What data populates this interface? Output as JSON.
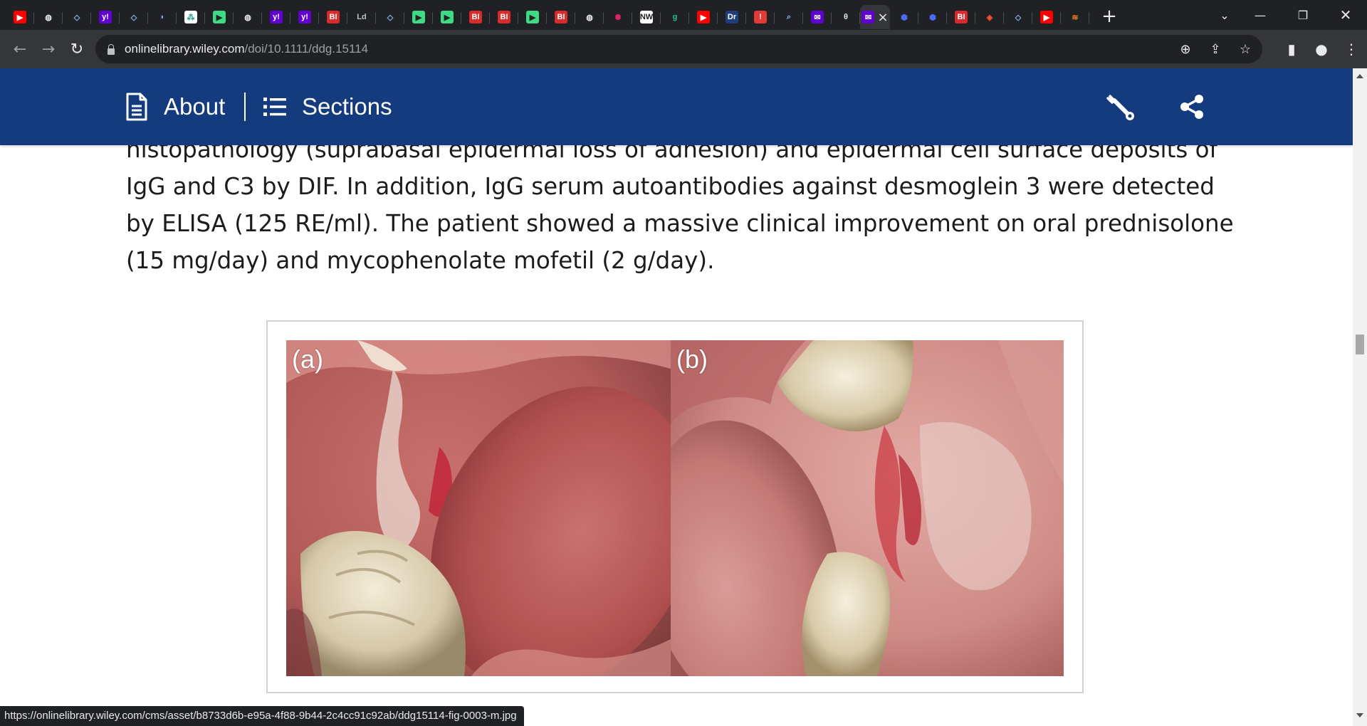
{
  "browser": {
    "tabs": [
      {
        "icon": "youtube-icon",
        "glyph": "▶",
        "bg": "#ff0000",
        "fg": "#ffffff"
      },
      {
        "icon": "globe-icon",
        "glyph": "◍",
        "bg": "#202124",
        "fg": "#e8eaed"
      },
      {
        "icon": "shield-icon",
        "glyph": "◇",
        "bg": "#202124",
        "fg": "#8ab4f8"
      },
      {
        "icon": "yahoo-icon",
        "glyph": "y!",
        "bg": "#6001d2",
        "fg": "#ffffff"
      },
      {
        "icon": "shield-icon",
        "glyph": "◇",
        "bg": "#202124",
        "fg": "#8ab4f8"
      },
      {
        "icon": "dart-icon",
        "glyph": "◗",
        "bg": "#202124",
        "fg": "#8ab4f8"
      },
      {
        "icon": "map-icon",
        "glyph": "⁂",
        "bg": "#ffffff",
        "fg": "#2a9d8f"
      },
      {
        "icon": "play-icon",
        "glyph": "▶",
        "bg": "#3ddc84",
        "fg": "#202124"
      },
      {
        "icon": "globe-icon",
        "glyph": "◍",
        "bg": "#202124",
        "fg": "#e8eaed"
      },
      {
        "icon": "yahoo-icon",
        "glyph": "y!",
        "bg": "#6001d2",
        "fg": "#ffffff"
      },
      {
        "icon": "yahoo-icon",
        "glyph": "y!",
        "bg": "#6001d2",
        "fg": "#ffffff"
      },
      {
        "icon": "business-insider-icon",
        "glyph": "BI",
        "bg": "#d92b2b",
        "fg": "#ffffff"
      },
      {
        "icon": "text-logo-icon",
        "glyph": "Ld",
        "bg": "#202124",
        "fg": "#bdc1c6"
      },
      {
        "icon": "shield-icon",
        "glyph": "◇",
        "bg": "#202124",
        "fg": "#8ab4f8"
      },
      {
        "icon": "play-icon",
        "glyph": "▶",
        "bg": "#3ddc84",
        "fg": "#202124"
      },
      {
        "icon": "play-icon",
        "glyph": "▶",
        "bg": "#3ddc84",
        "fg": "#202124"
      },
      {
        "icon": "business-insider-icon",
        "glyph": "BI",
        "bg": "#d92b2b",
        "fg": "#ffffff"
      },
      {
        "icon": "business-insider-icon",
        "glyph": "BI",
        "bg": "#d92b2b",
        "fg": "#ffffff"
      },
      {
        "icon": "play-icon",
        "glyph": "▶",
        "bg": "#3ddc84",
        "fg": "#202124"
      },
      {
        "icon": "business-insider-icon",
        "glyph": "BI",
        "bg": "#d92b2b",
        "fg": "#ffffff"
      },
      {
        "icon": "globe-icon",
        "glyph": "◍",
        "bg": "#202124",
        "fg": "#e8eaed"
      },
      {
        "icon": "starburst-icon",
        "glyph": "✺",
        "bg": "#202124",
        "fg": "#e0245e"
      },
      {
        "icon": "news-logo-icon",
        "glyph": "NW",
        "bg": "#ffffff",
        "fg": "#202124"
      },
      {
        "icon": "g-logo-icon",
        "glyph": "g",
        "bg": "#202124",
        "fg": "#15c39a"
      },
      {
        "icon": "youtube-icon",
        "glyph": "▶",
        "bg": "#ff0000",
        "fg": "#ffffff"
      },
      {
        "icon": "dr-logo-icon",
        "glyph": "Dr",
        "bg": "#1f3f7a",
        "fg": "#ffffff"
      },
      {
        "icon": "red-exclaim-icon",
        "glyph": "!",
        "bg": "#e53935",
        "fg": "#ffffff"
      },
      {
        "icon": "search-icon",
        "glyph": "⌕",
        "bg": "#202124",
        "fg": "#8ab4f8"
      },
      {
        "icon": "mail-icon",
        "glyph": "✉",
        "bg": "#6001d2",
        "fg": "#ffffff"
      },
      {
        "icon": "theta-icon",
        "glyph": "θ",
        "bg": "#202124",
        "fg": "#e8eaed"
      },
      {
        "icon": "mail-icon",
        "glyph": "✉",
        "bg": "#6001d2",
        "fg": "#ffffff",
        "active": true
      },
      {
        "icon": "cube-icon",
        "glyph": "⬢",
        "bg": "#202124",
        "fg": "#4a6cf7"
      },
      {
        "icon": "cube-icon",
        "glyph": "⬢",
        "bg": "#202124",
        "fg": "#4a6cf7"
      },
      {
        "icon": "business-insider-icon",
        "glyph": "BI",
        "bg": "#d92b2b",
        "fg": "#ffffff"
      },
      {
        "icon": "brave-icon",
        "glyph": "◈",
        "bg": "#202124",
        "fg": "#fb542b"
      },
      {
        "icon": "shield-icon",
        "glyph": "◇",
        "bg": "#202124",
        "fg": "#8ab4f8"
      },
      {
        "icon": "youtube-icon",
        "glyph": "▶",
        "bg": "#ff0000",
        "fg": "#ffffff"
      },
      {
        "icon": "stack-icon",
        "glyph": "≋",
        "bg": "#202124",
        "fg": "#f48024"
      }
    ],
    "url_host": "onlinelibrary.wiley.com",
    "url_path": "/doi/10.1111/ddg.15114",
    "status_url": "https://onlinelibrary.wiley.com/cms/asset/b8733d6b-e95a-4f88-9b44-2c4cc91c92ab/ddg15114-fig-0003-m.jpg"
  },
  "site_header": {
    "about_label": "About",
    "sections_label": "Sections"
  },
  "article": {
    "paragraph": "histopathology (suprabasal epidermal loss of adhesion) and epidermal cell surface deposits of IgG and C3 by DIF. In addition, IgG serum autoantibodies against desmoglein 3 were detected by ELISA (125 RE/ml). The patient showed a massive clinical improvement on oral prednisolone (15 mg/day) and mycophenolate mofetil (2 g/day)."
  },
  "figure": {
    "panel_a_label": "(a)",
    "panel_b_label": "(b)"
  }
}
